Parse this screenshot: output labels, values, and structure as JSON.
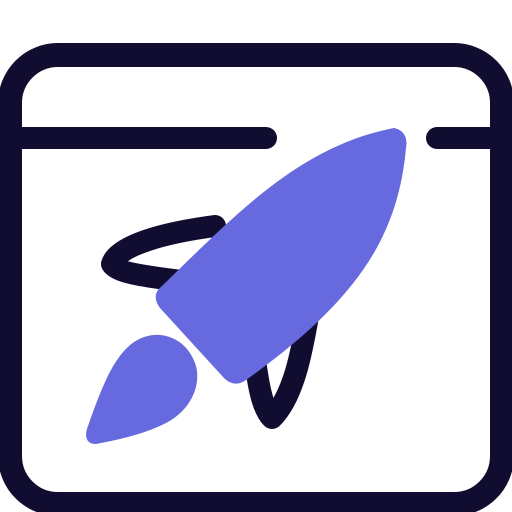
{
  "icon": {
    "name": "browser-window-rocket-icon",
    "colors": {
      "outline": "#100d31",
      "accent": "#6769de",
      "background": "#ffffff"
    }
  }
}
